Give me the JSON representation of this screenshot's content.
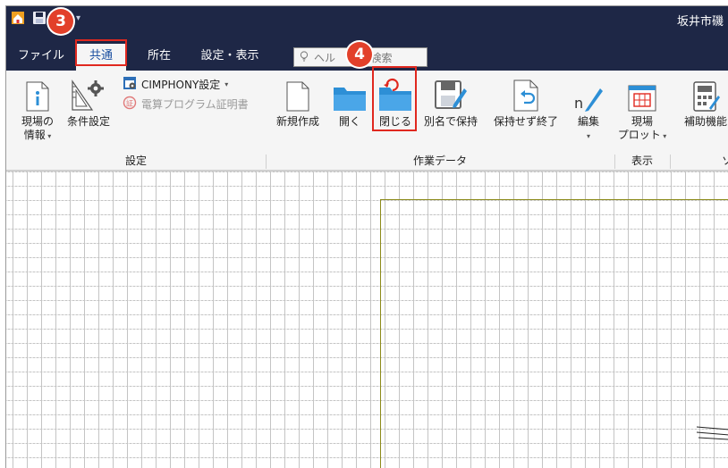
{
  "window": {
    "title": "坂井市磯",
    "qat": {
      "app_icon": "house-icon",
      "save_icon": "save-icon",
      "folder_icon": "folder-icon",
      "dropdown_icon": "qat-dropdown-icon"
    }
  },
  "tabs": [
    {
      "label": "ファイル",
      "active": false
    },
    {
      "label": "共通",
      "active": true
    },
    {
      "label": "所在",
      "active": false
    },
    {
      "label": "設定・表示",
      "active": false
    }
  ],
  "search": {
    "text": "ヘル",
    "suffix": "Q検索",
    "icon": "lightbulb-icon"
  },
  "ribbon": {
    "settings_group": {
      "label": "設定",
      "site_info": {
        "line1": "現場の",
        "line2": "情報",
        "icon": "info-document-icon"
      },
      "conditions": {
        "label": "条件設定",
        "icon": "ruler-gear-icon"
      },
      "cimphony": {
        "label": "CIMPHONY設定",
        "icon": "settings-window-icon"
      },
      "certificate": {
        "label": "電算プログラム証明書",
        "icon": "certificate-icon"
      }
    },
    "data_group": {
      "label": "作業データ",
      "new": {
        "label": "新規作成",
        "icon": "new-document-icon"
      },
      "open": {
        "label": "開く",
        "icon": "open-folder-icon"
      },
      "close": {
        "label": "閉じる",
        "icon": "close-folder-icon"
      },
      "save_as": {
        "label": "別名で保持",
        "icon": "save-as-icon"
      },
      "exit_no_save": {
        "label": "保持せず終了",
        "icon": "exit-document-icon"
      },
      "edit": {
        "label": "編集",
        "icon": "edit-pen-icon"
      }
    },
    "display_group": {
      "label": "表示",
      "site_plot": {
        "line1": "現場",
        "line2": "プロット",
        "icon": "plot-grid-icon"
      }
    },
    "aux_group": {
      "label": "ソ",
      "aux": {
        "label": "補助機能",
        "icon": "calculator-icon"
      }
    }
  },
  "annotations": {
    "step3": "3",
    "step4": "4",
    "color": "#e2402a"
  }
}
